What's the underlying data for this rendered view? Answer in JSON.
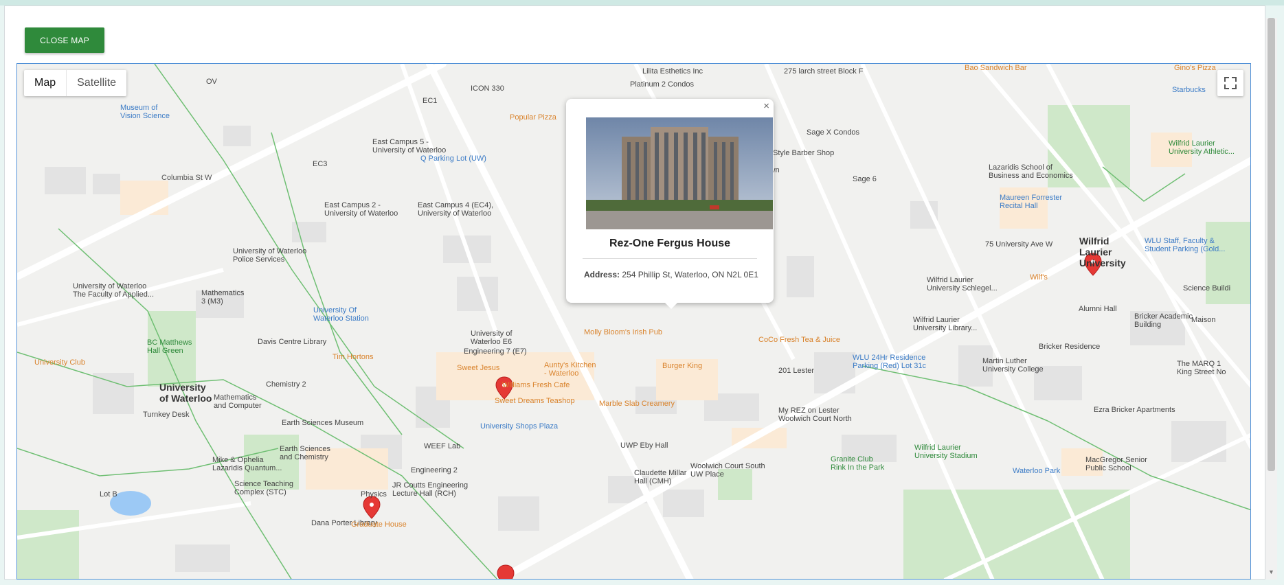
{
  "page": {
    "close_map_label": "CLOSE MAP"
  },
  "map": {
    "map_type": {
      "map": "Map",
      "satellite": "Satellite"
    },
    "labels": [
      {
        "t": "Museum of\nVision Science",
        "c": "blue"
      },
      {
        "t": "Columbia St W",
        "c": ""
      },
      {
        "t": "EC3",
        "c": "poi"
      },
      {
        "t": "EC1",
        "c": "poi"
      },
      {
        "t": "ICON 330",
        "c": "poi"
      },
      {
        "t": "Popular Pizza",
        "c": "orange"
      },
      {
        "t": "East Campus 5 -\nUniversity of Waterloo",
        "c": "poi"
      },
      {
        "t": "Q Parking Lot (UW)",
        "c": "blue"
      },
      {
        "t": "East Campus 2 -\nUniversity of Waterloo",
        "c": "poi"
      },
      {
        "t": "East Campus 4 (EC4),\nUniversity of Waterloo",
        "c": "poi"
      },
      {
        "t": "University of Waterloo\nPolice Services",
        "c": "poi"
      },
      {
        "t": "University of Waterloo\nThe Faculty of Applied...",
        "c": "poi"
      },
      {
        "t": "Mathematics\n3 (M3)",
        "c": "poi"
      },
      {
        "t": "University Of\nWaterloo Station",
        "c": "blue"
      },
      {
        "t": "BC Matthews\nHall Green",
        "c": "green"
      },
      {
        "t": "Davis Centre Library",
        "c": "poi"
      },
      {
        "t": "Tim Hortons",
        "c": "orange"
      },
      {
        "t": "University of\nWaterloo E6",
        "c": "poi"
      },
      {
        "t": "Engineering 7 (E7)",
        "c": "poi"
      },
      {
        "t": "Molly Bloom's Irish Pub",
        "c": "orange"
      },
      {
        "t": "University Club",
        "c": "orange"
      },
      {
        "t": "University\nof Waterloo",
        "c": "bold"
      },
      {
        "t": "Mathematics\nand Computer",
        "c": "poi"
      },
      {
        "t": "Chemistry 2",
        "c": "poi"
      },
      {
        "t": "Sweet Jesus",
        "c": "orange"
      },
      {
        "t": "Aunty's Kitchen\n- Waterloo",
        "c": "orange"
      },
      {
        "t": "Williams Fresh Cafe",
        "c": "orange"
      },
      {
        "t": "Sweet Dreams Teashop",
        "c": "orange"
      },
      {
        "t": "Burger King",
        "c": "orange"
      },
      {
        "t": "Marble Slab Creamery",
        "c": "orange"
      },
      {
        "t": "Turnkey Desk",
        "c": "poi"
      },
      {
        "t": "Earth Sciences Museum",
        "c": "poi"
      },
      {
        "t": "Earth Sciences\nand Chemistry",
        "c": "poi"
      },
      {
        "t": "University Shops Plaza",
        "c": "blue"
      },
      {
        "t": "WEEF Lab",
        "c": "poi"
      },
      {
        "t": "Engineering 2",
        "c": "poi"
      },
      {
        "t": "Mike & Ophelia\nLazaridis Quantum...",
        "c": "poi"
      },
      {
        "t": "Science Teaching\nComplex (STC)",
        "c": "poi"
      },
      {
        "t": "Physics",
        "c": "poi"
      },
      {
        "t": "JR Coutts Engineering\nLecture Hall (RCH)",
        "c": "poi"
      },
      {
        "t": "Dana Porter Library",
        "c": "poi"
      },
      {
        "t": "Graduate House",
        "c": "orange"
      },
      {
        "t": "Lilita Esthetics Inc",
        "c": "poi"
      },
      {
        "t": "Platinum 2 Condos",
        "c": "poi"
      },
      {
        "t": "275 larch street Block F",
        "c": "poi"
      },
      {
        "t": "Sage X Condos",
        "c": "poi"
      },
      {
        "t": "City Style Barber Shop",
        "c": "poi"
      },
      {
        "t": "Ivy Town",
        "c": "poi"
      },
      {
        "t": "Sage 6",
        "c": "poi"
      },
      {
        "t": "Bao Sandwich Bar",
        "c": "orange"
      },
      {
        "t": "Gino's Pizza",
        "c": "orange"
      },
      {
        "t": "Starbucks",
        "c": "blue"
      },
      {
        "t": "Lazaridis School of\nBusiness and Economics",
        "c": "poi"
      },
      {
        "t": "Wilfrid Laurier\nUniversity Athletic...",
        "c": "green"
      },
      {
        "t": "Maureen Forrester\nRecital Hall",
        "c": "blue"
      },
      {
        "t": "75 University Ave W",
        "c": "poi"
      },
      {
        "t": "Wilfrid\nLaurier\nUniversity",
        "c": "bold"
      },
      {
        "t": "WLU Staff, Faculty &\nStudent Parking (Gold...",
        "c": "blue"
      },
      {
        "t": "Wilf's",
        "c": "orange"
      },
      {
        "t": "Wilfrid Laurier\nUniversity Schlegel...",
        "c": "poi"
      },
      {
        "t": "Alumni Hall",
        "c": "poi"
      },
      {
        "t": "Wilfrid Laurier\nUniversity Library...",
        "c": "poi"
      },
      {
        "t": "Bricker Academic\nBuilding",
        "c": "poi"
      },
      {
        "t": "Science Buildi",
        "c": "poi"
      },
      {
        "t": "Maison",
        "c": "poi"
      },
      {
        "t": "CoCo Fresh Tea & Juice",
        "c": "orange"
      },
      {
        "t": "WLU 24Hr Residence\nParking (Red) Lot 31c",
        "c": "blue"
      },
      {
        "t": "201 Lester",
        "c": "poi"
      },
      {
        "t": "Bricker Residence",
        "c": "poi"
      },
      {
        "t": "Martin Luther\nUniversity College",
        "c": "poi"
      },
      {
        "t": "The MARQ 1\nKing Street No",
        "c": "poi"
      },
      {
        "t": "My REZ on Lester\nWoolwich Court North",
        "c": "poi"
      },
      {
        "t": "Ezra Bricker Apartments",
        "c": "poi"
      },
      {
        "t": "UWP Eby Hall",
        "c": "poi"
      },
      {
        "t": "Claudette Millar\nHall (CMH)",
        "c": "poi"
      },
      {
        "t": "Woolwich Court South\nUW Place",
        "c": "poi"
      },
      {
        "t": "Granite Club\nRink In the Park",
        "c": "green"
      },
      {
        "t": "Wilfrid Laurier\nUniversity Stadium",
        "c": "green"
      },
      {
        "t": "Waterloo Park",
        "c": "blue"
      },
      {
        "t": "MacGregor Senior\nPublic School",
        "c": "poi"
      },
      {
        "t": "OV",
        "c": "poi"
      },
      {
        "t": "Lot B",
        "c": "poi"
      }
    ]
  },
  "info_window": {
    "title": "Rez-One Fergus House",
    "address_label": "Address:",
    "address": "254 Phillip St, Waterloo, ON N2L 0E1",
    "close": "×"
  },
  "colors": {
    "button_green": "#2f8a3b",
    "map_border": "#4f8fd6",
    "marker_red": "#e53935"
  }
}
